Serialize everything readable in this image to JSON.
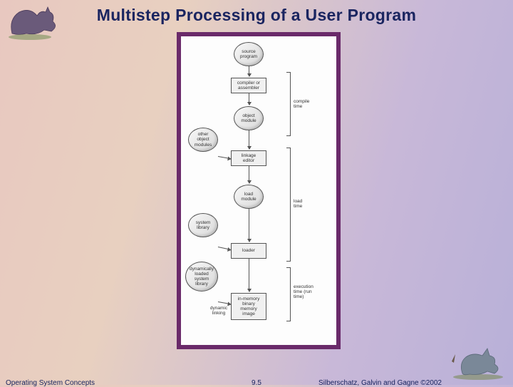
{
  "title": "Multistep Processing of a User Program",
  "footer": {
    "left": "Operating System Concepts",
    "center": "9.5",
    "right": "Silberschatz, Galvin and Gagne ©2002"
  },
  "diagram": {
    "nodes": {
      "source": "source\nprogram",
      "compiler": "compiler or\nassembler",
      "object": "object\nmodule",
      "other_modules": "other\nobject\nmodules",
      "linker": "linkage\neditor",
      "load_module": "load\nmodule",
      "sys_library": "system\nlibrary",
      "loader": "loader",
      "dyn_library": "dynamically\nloaded\nsystem\nlibrary",
      "dynamic_linking": "dynamic\nlinking",
      "memory_image": "in-memory\nbinary\nmemory\nimage"
    },
    "phases": {
      "compile": "compile\ntime",
      "load": "load\ntime",
      "execution": "execution\ntime (run\ntime)"
    }
  }
}
